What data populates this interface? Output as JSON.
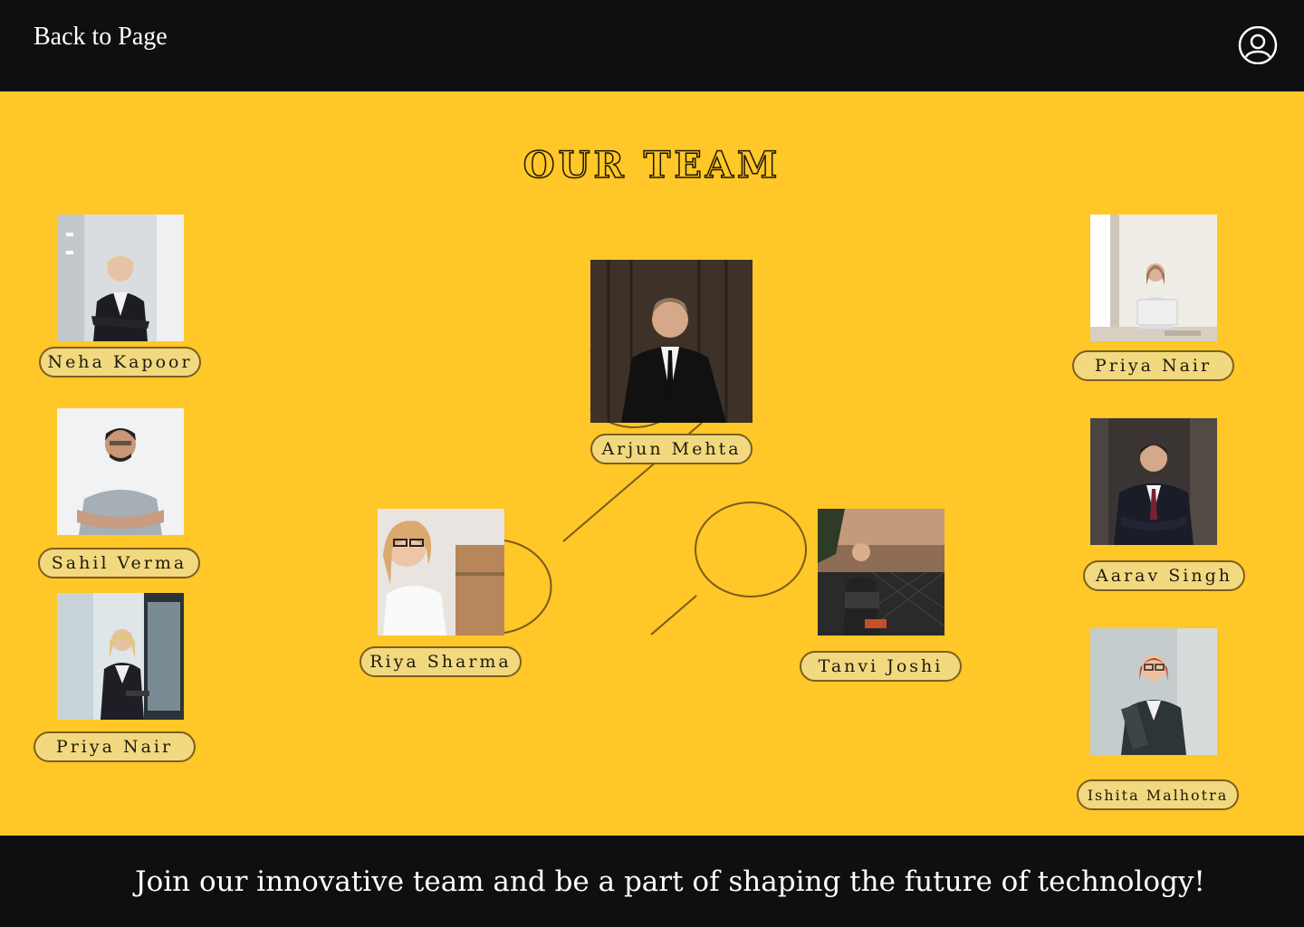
{
  "header": {
    "back_label": "Back to Page",
    "user_icon": "user-circle-icon"
  },
  "main": {
    "title": "OUR TEAM",
    "members": [
      {
        "name": "Neha Kapoor"
      },
      {
        "name": "Sahil Verma"
      },
      {
        "name": "Priya Nair"
      },
      {
        "name": "Arjun Mehta"
      },
      {
        "name": "Riya Sharma"
      },
      {
        "name": "Tanvi Joshi"
      },
      {
        "name": "Priya Nair"
      },
      {
        "name": "Aarav Singh"
      },
      {
        "name": "Ishita Malhotra"
      }
    ]
  },
  "footer": {
    "tagline": "Join our innovative team and be a part of shaping the future of technology!"
  },
  "colors": {
    "background": "#ffc727",
    "bar": "#0f0f12",
    "name_pill": "#f2d980",
    "pill_border": "#7c5e20"
  }
}
